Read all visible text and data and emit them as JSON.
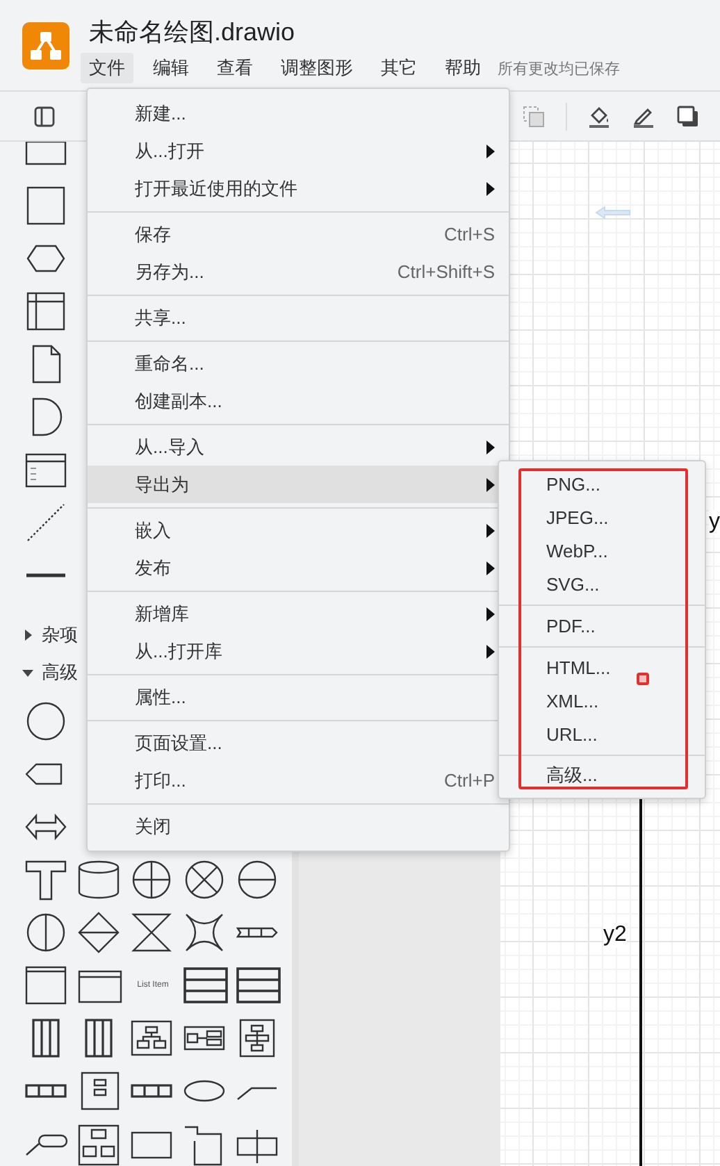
{
  "window": {
    "title": "未命名绘图.drawio"
  },
  "menu_bar": {
    "items": [
      {
        "label": "文件",
        "selected": true
      },
      {
        "label": "编辑",
        "selected": false
      },
      {
        "label": "查看",
        "selected": false
      },
      {
        "label": "调整图形",
        "selected": false
      },
      {
        "label": "其它",
        "selected": false
      },
      {
        "label": "帮助",
        "selected": false
      }
    ],
    "status": "所有更改均已保存"
  },
  "sidebar": {
    "sections": [
      {
        "label": "杂项",
        "expanded": false
      },
      {
        "label": "高级",
        "expanded": true,
        "preview_text": "List Item"
      }
    ]
  },
  "file_menu": {
    "groups": [
      {
        "items": [
          {
            "label": "新建...",
            "submenu": false,
            "selected": false
          },
          {
            "label": "从...打开",
            "submenu": true,
            "selected": false
          },
          {
            "label": "打开最近使用的文件",
            "submenu": true,
            "selected": false
          }
        ]
      },
      {
        "items": [
          {
            "label": "保存",
            "shortcut": "Ctrl+S",
            "submenu": false,
            "selected": false
          },
          {
            "label": "另存为...",
            "shortcut": "Ctrl+Shift+S",
            "submenu": false,
            "selected": false
          }
        ]
      },
      {
        "items": [
          {
            "label": "共享...",
            "submenu": false,
            "selected": false
          }
        ]
      },
      {
        "items": [
          {
            "label": "重命名...",
            "submenu": false,
            "selected": false
          },
          {
            "label": "创建副本...",
            "submenu": false,
            "selected": false
          }
        ]
      },
      {
        "items": [
          {
            "label": "从...导入",
            "submenu": true,
            "selected": false
          },
          {
            "label": "导出为",
            "submenu": true,
            "selected": true
          }
        ]
      },
      {
        "items": [
          {
            "label": "嵌入",
            "submenu": true,
            "selected": false
          },
          {
            "label": "发布",
            "submenu": true,
            "selected": false
          }
        ]
      },
      {
        "items": [
          {
            "label": "新增库",
            "submenu": true,
            "selected": false
          },
          {
            "label": "从...打开库",
            "submenu": true,
            "selected": false
          }
        ]
      },
      {
        "items": [
          {
            "label": "属性...",
            "submenu": false,
            "selected": false
          }
        ]
      },
      {
        "items": [
          {
            "label": "页面设置...",
            "submenu": false,
            "selected": false
          },
          {
            "label": "打印...",
            "shortcut": "Ctrl+P",
            "submenu": false,
            "selected": false
          }
        ]
      },
      {
        "items": [
          {
            "label": "关闭",
            "submenu": false,
            "selected": false
          }
        ]
      }
    ]
  },
  "export_submenu": {
    "groups": [
      {
        "items": [
          "PNG...",
          "JPEG...",
          "WebP...",
          "SVG..."
        ]
      },
      {
        "items": [
          "PDF..."
        ]
      },
      {
        "items": [
          "HTML...",
          "XML...",
          "URL..."
        ]
      },
      {
        "items": [
          "高级..."
        ]
      }
    ]
  },
  "canvas": {
    "labels": [
      {
        "text": "y2",
        "kind": "edge"
      },
      {
        "text": "y",
        "kind": "edge-cut"
      }
    ]
  }
}
